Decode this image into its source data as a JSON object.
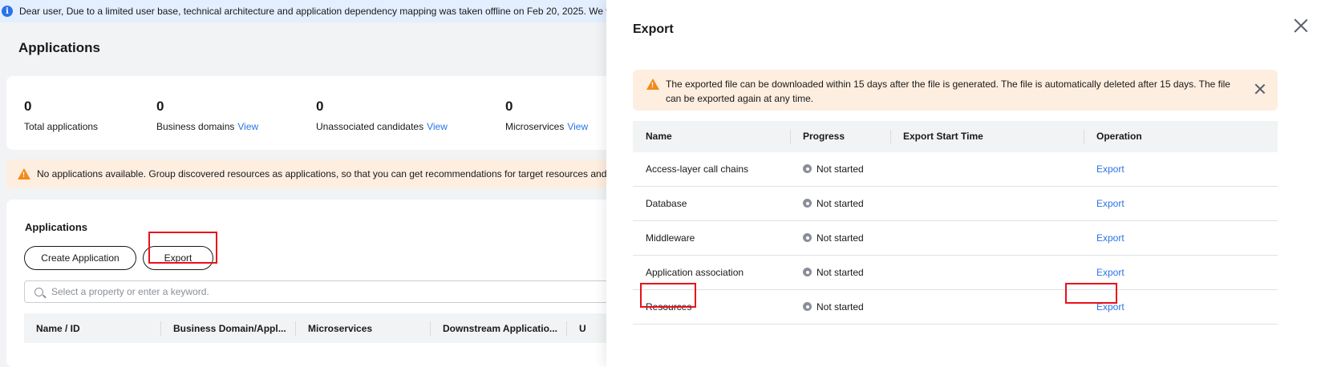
{
  "notice_bar": {
    "text": "Dear user, Due to a limited user base, technical architecture and application dependency mapping was taken offline on Feb 20, 2025. We w"
  },
  "page": {
    "title": "Applications"
  },
  "stats": [
    {
      "value": "0",
      "label": "Total applications",
      "link": ""
    },
    {
      "value": "0",
      "label": "Business domains",
      "link": "View"
    },
    {
      "value": "0",
      "label": "Unassociated candidates",
      "link": "View"
    },
    {
      "value": "0",
      "label": "Microservices",
      "link": "View"
    }
  ],
  "warning_bar": {
    "text": "No applications available. Group discovered resources as applications, so that you can get recommendations for target resources and"
  },
  "applications_section": {
    "title": "Applications",
    "create_button": "Create Application",
    "export_button": "Export",
    "search_placeholder": "Select a property or enter a keyword.",
    "columns": [
      "Name / ID",
      "Business Domain/Appl...",
      "Microservices",
      "Downstream Applicatio...",
      "U"
    ]
  },
  "export_drawer": {
    "title": "Export",
    "warning": "The exported file can be downloaded within 15 days after the file is generated. The file is automatically deleted after 15 days. The file can be exported again at any time.",
    "columns": {
      "name": "Name",
      "progress": "Progress",
      "start_time": "Export Start Time",
      "operation": "Operation"
    },
    "rows": [
      {
        "name": "Access-layer call chains",
        "progress": "Not started",
        "start_time": "",
        "operation": "Export"
      },
      {
        "name": "Database",
        "progress": "Not started",
        "start_time": "",
        "operation": "Export"
      },
      {
        "name": "Middleware",
        "progress": "Not started",
        "start_time": "",
        "operation": "Export"
      },
      {
        "name": "Application association",
        "progress": "Not started",
        "start_time": "",
        "operation": "Export"
      },
      {
        "name": "Resources",
        "progress": "Not started",
        "start_time": "",
        "operation": "Export"
      }
    ]
  },
  "colors": {
    "accent": "#2b73e8",
    "warning": "#f28a1a",
    "highlight_box": "#e8111b",
    "status_grey": "#8a8e99"
  }
}
